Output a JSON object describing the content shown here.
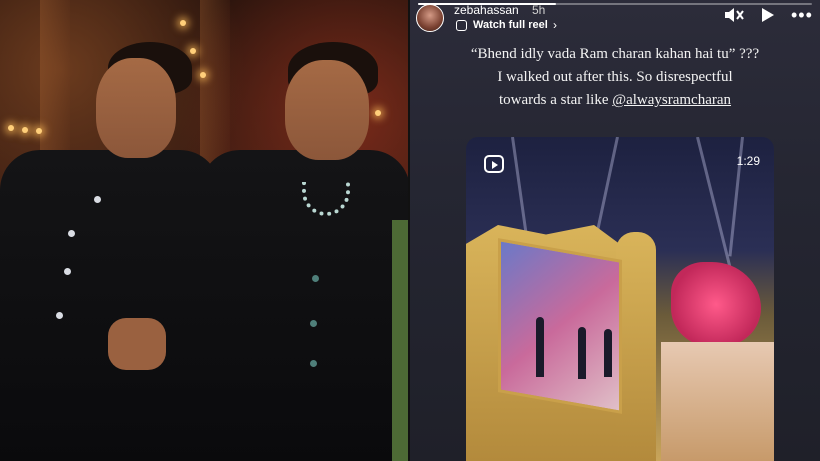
{
  "story": {
    "username": "zebahassan",
    "time_ago": "5h",
    "reel_link_label": "Watch full reel",
    "progress": 0.35,
    "icons": {
      "avatar": "profile-avatar",
      "reel": "reels-icon",
      "chevron": "chevron-right-icon",
      "mute": "speaker-muted-icon",
      "play": "play-icon",
      "more": "more-horizontal-icon"
    },
    "caption": {
      "line1": "“Bhend idly vada Ram charan kahan hai tu” ???",
      "line2": "I walked out after this. So disrespectful",
      "line3_prefix": "towards a star like ",
      "mention": "@alwaysramcharan"
    },
    "embedded_reel": {
      "duration": "1:29"
    }
  },
  "colors": {
    "story_bg": "#262733",
    "text": "#ffffff",
    "photo_suit": "#0f0f12"
  }
}
